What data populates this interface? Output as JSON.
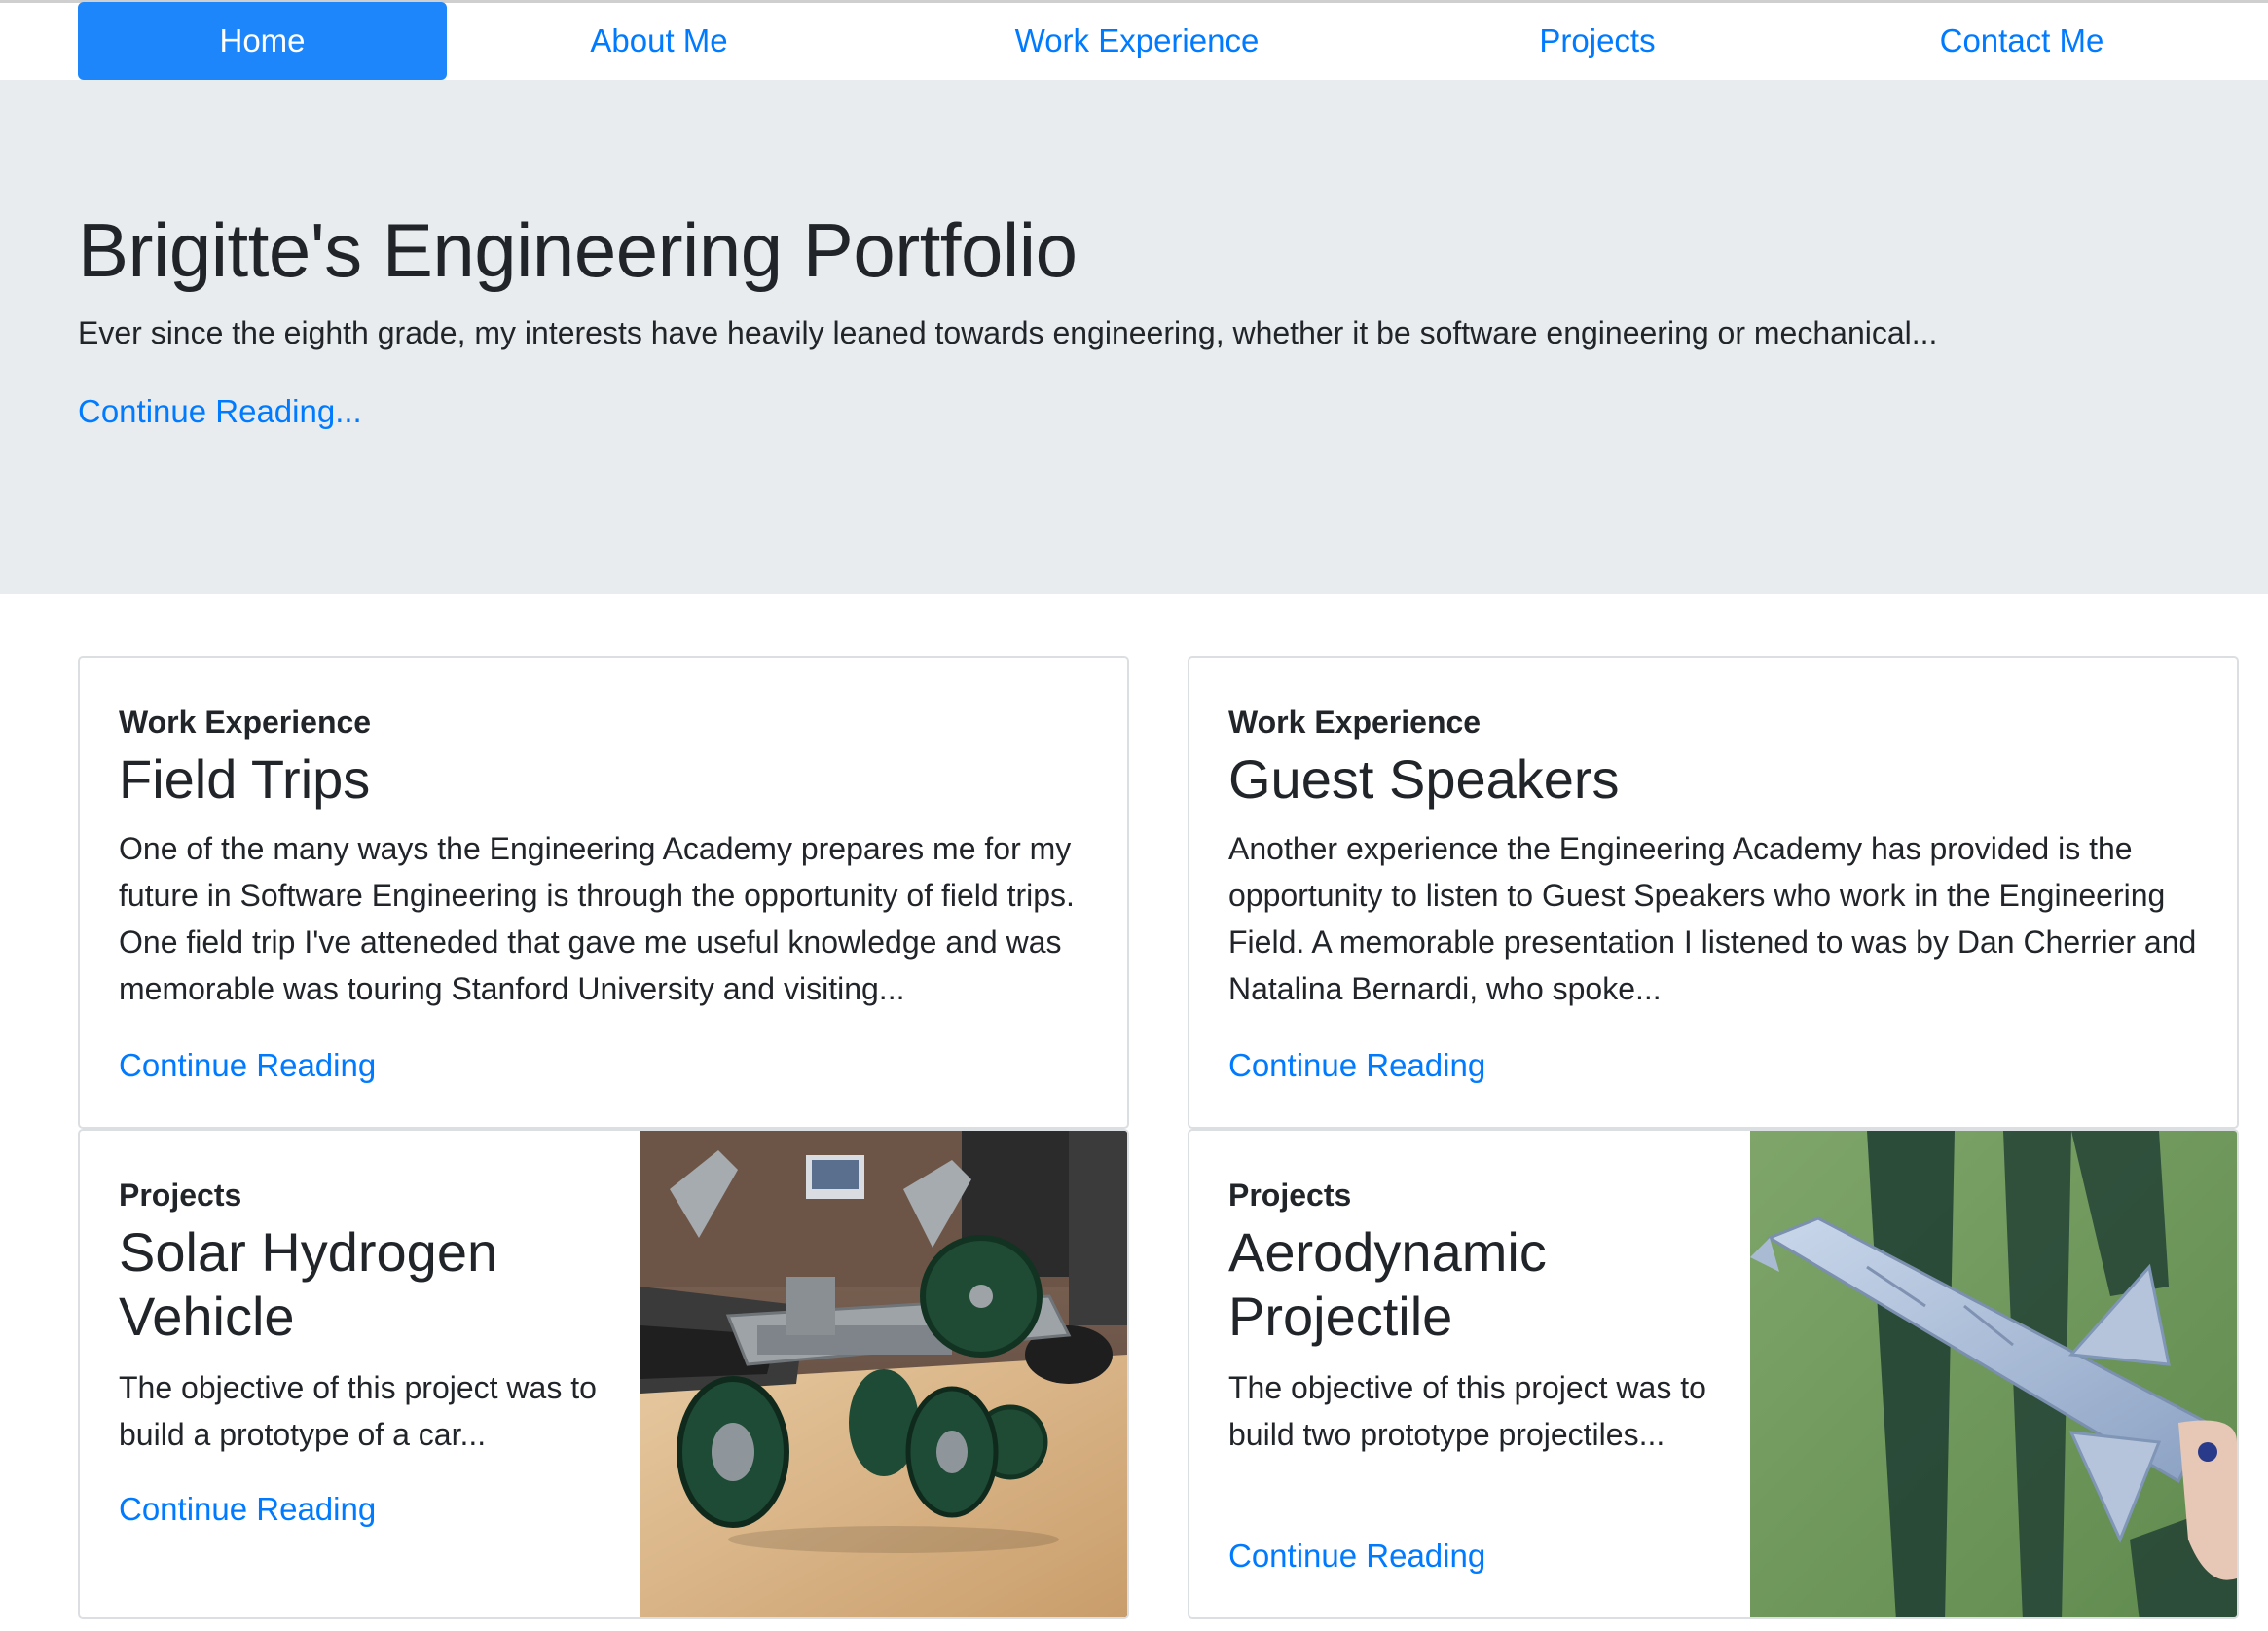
{
  "nav": {
    "items": [
      {
        "label": "Home"
      },
      {
        "label": "About Me"
      },
      {
        "label": "Work Experience"
      },
      {
        "label": "Projects"
      },
      {
        "label": "Contact Me"
      }
    ]
  },
  "hero": {
    "title": "Brigitte's Engineering Portfolio",
    "lead": "Ever since the eighth grade, my interests have heavily leaned towards engineering, whether it be software engineering or mechanical...",
    "link": "Continue Reading..."
  },
  "cards": [
    {
      "kicker": "Work Experience",
      "title": "Field Trips",
      "body": "One of the many ways the Engineering Academy prepares me for my future in Software Engineering is through the opportunity of field trips. One field trip I've atteneded that gave me useful knowledge and was memorable was touring Stanford University and visiting...",
      "link": "Continue Reading"
    },
    {
      "kicker": "Work Experience",
      "title": "Guest Speakers",
      "body": "Another experience the Engineering Academy has provided is the opportunity to listen to Guest Speakers who work in the Engineering Field. A memorable presentation I listened to was by Dan Cherrier and Natalina Bernardi, who spoke...",
      "link": "Continue Reading"
    },
    {
      "kicker": "Projects",
      "title": "Solar Hydrogen Vehicle",
      "body": "The objective of this project was to build a prototype of a car...",
      "link": "Continue Reading"
    },
    {
      "kicker": "Projects",
      "title": "Aerodynamic Projectile",
      "body": "The objective of this project was to build two prototype projectiles...",
      "link": "Continue Reading"
    }
  ],
  "colors": {
    "primary": "#007bff",
    "active_bg": "#1d86fb",
    "hero_bg": "#e9ecef",
    "text": "#212529",
    "card_border": "#dcdfe2"
  }
}
